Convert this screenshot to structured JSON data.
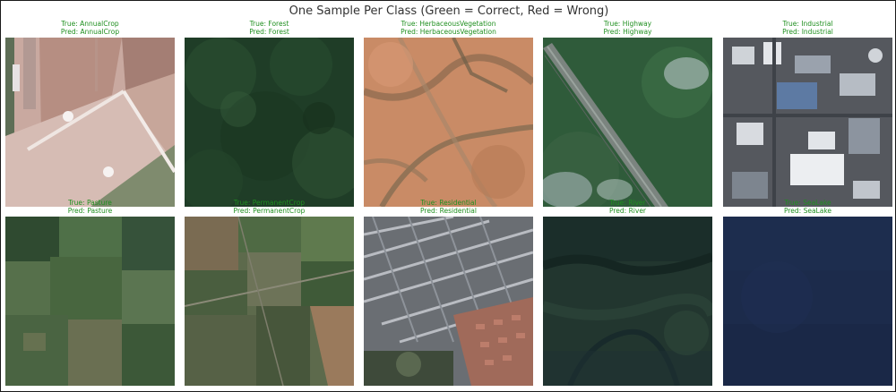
{
  "figure": {
    "title": "One Sample Per Class (Green = Correct, Red = Wrong)",
    "colors": {
      "correct": "#1f8f1f",
      "wrong": "#d62728",
      "title_text": "#333333"
    }
  },
  "samples": [
    {
      "true_label": "True: AnnualCrop",
      "pred_label": "Pred: AnnualCrop",
      "correct": true
    },
    {
      "true_label": "True: Forest",
      "pred_label": "Pred: Forest",
      "correct": true
    },
    {
      "true_label": "True: HerbaceousVegetation",
      "pred_label": "Pred: HerbaceousVegetation",
      "correct": true
    },
    {
      "true_label": "True: Highway",
      "pred_label": "Pred: Highway",
      "correct": true
    },
    {
      "true_label": "True: Industrial",
      "pred_label": "Pred: Industrial",
      "correct": true
    },
    {
      "true_label": "True: Pasture",
      "pred_label": "Pred: Pasture",
      "correct": true
    },
    {
      "true_label": "True: PermanentCrop",
      "pred_label": "Pred: PermanentCrop",
      "correct": true
    },
    {
      "true_label": "True: Residential",
      "pred_label": "Pred: Residential",
      "correct": true
    },
    {
      "true_label": "True: River",
      "pred_label": "Pred: River",
      "correct": true
    },
    {
      "true_label": "True: SeaLake",
      "pred_label": "Pred: SeaLake",
      "correct": true
    }
  ]
}
